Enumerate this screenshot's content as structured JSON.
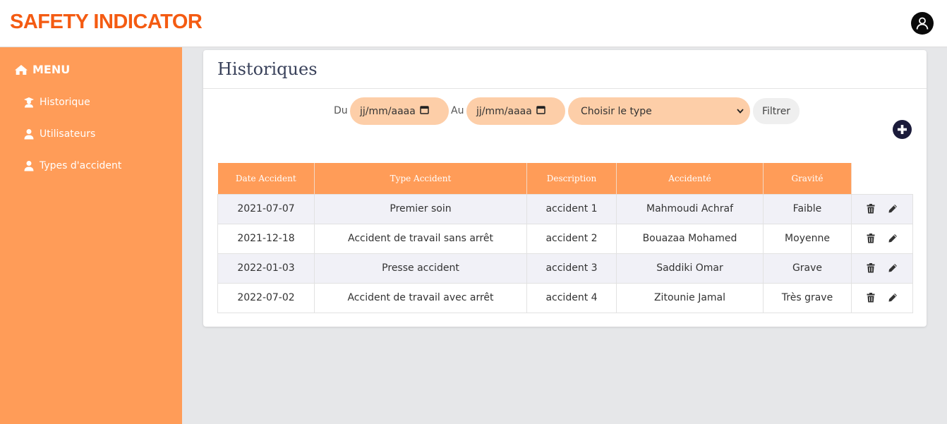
{
  "colors": {
    "brand": "#f45b12",
    "sidebar": "#ff9c58",
    "table_header": "#ff9c58",
    "input_fill": "#fdcea8",
    "title_text": "#39415a"
  },
  "header": {
    "brand": "SAFETY INDICATOR",
    "avatar_icon": "user-circle-icon"
  },
  "sidebar": {
    "menu_label": "MENU",
    "menu_icon": "home-icon",
    "items": [
      {
        "label": "Historique",
        "icon": "user-graduate-icon"
      },
      {
        "label": "Utilisateurs",
        "icon": "user-icon"
      },
      {
        "label": "Types d'accident",
        "icon": "user-icon"
      }
    ]
  },
  "main": {
    "title": "Historiques",
    "filter": {
      "from_label": "Du",
      "to_label": "Au",
      "from_value": "jj/mm/aaaa",
      "to_value": "jj/mm/aaaa",
      "type_select": "Choisir le type",
      "filter_button": "Filtrer"
    },
    "add_icon": "plus-circle-icon",
    "table": {
      "columns": [
        "Date Accident",
        "Type Accident",
        "Description",
        "Accidenté",
        "Gravité"
      ],
      "rows": [
        {
          "date": "2021-07-07",
          "type": "Premier soin",
          "description": "accident 1",
          "person": "Mahmoudi Achraf",
          "severity": "Faible"
        },
        {
          "date": "2021-12-18",
          "type": "Accident de travail sans arrêt",
          "description": "accident 2",
          "person": "Bouazaa Mohamed",
          "severity": "Moyenne"
        },
        {
          "date": "2022-01-03",
          "type": "Presse accident",
          "description": "accident 3",
          "person": "Saddiki Omar",
          "severity": "Grave"
        },
        {
          "date": "2022-07-02",
          "type": "Accident de travail avec arrêt",
          "description": "accident 4",
          "person": "Zitounie Jamal",
          "severity": "Très grave"
        }
      ],
      "row_actions": [
        "trash-icon",
        "pencil-icon"
      ]
    }
  }
}
